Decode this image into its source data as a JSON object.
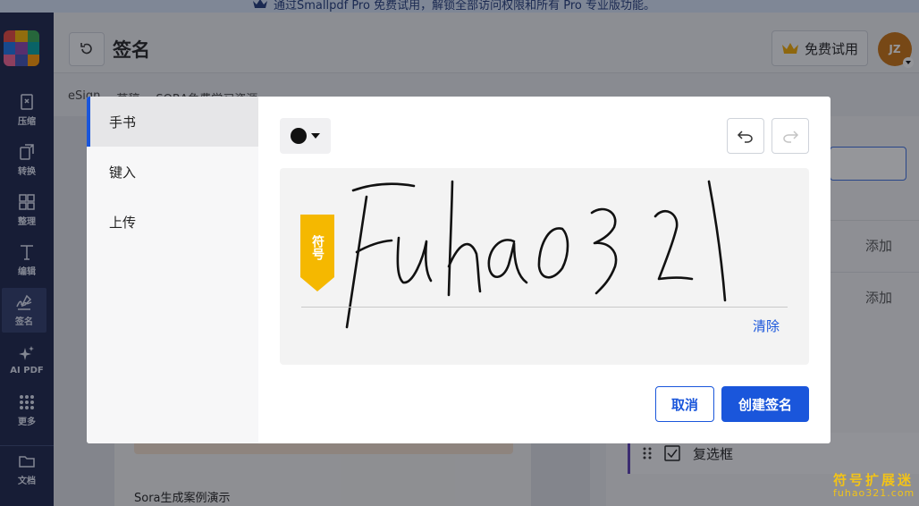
{
  "promo": {
    "text": "通过Smallpdf Pro 免费试用，解锁全部访问权限和所有 Pro 专业版功能。"
  },
  "sidebar": {
    "items": [
      {
        "label": "压缩",
        "icon": "compress-icon"
      },
      {
        "label": "转换",
        "icon": "convert-icon"
      },
      {
        "label": "整理",
        "icon": "organize-icon"
      },
      {
        "label": "编辑",
        "icon": "edit-icon"
      },
      {
        "label": "签名",
        "icon": "sign-icon"
      },
      {
        "label": "AI PDF",
        "icon": "ai-sparkle-icon"
      },
      {
        "label": "更多",
        "icon": "more-grid-icon"
      },
      {
        "label": "文档",
        "icon": "folder-icon"
      }
    ],
    "active": "签名",
    "logo_colors": [
      "#e8453c",
      "#f7b500",
      "#35a853",
      "#1b74e8",
      "#8e44ad",
      "#00a3a3",
      "#f06292",
      "#3f51b5",
      "#ff9800"
    ]
  },
  "header": {
    "title": "签名",
    "trial_label": "免费试用",
    "avatar_initials": "JZ"
  },
  "breadcrumbs": [
    "eSign",
    "草稿",
    "SORA免费学习资源"
  ],
  "background": {
    "doc_caption": "Sora生成案例演示",
    "add_label_1": "添加",
    "add_label_2": "添加",
    "checkbox_label": "复选框"
  },
  "modal": {
    "tabs": [
      "手书",
      "键入",
      "上传"
    ],
    "active_tab": "手书",
    "pen_color": "#111111",
    "tag_text": "符号",
    "clear_label": "清除",
    "cancel_label": "取消",
    "create_label": "创建签名"
  },
  "watermark": {
    "line1": "符号扩展迷",
    "line2": "fuhao321.com"
  },
  "colors": {
    "accent": "#1a56db",
    "sidebar_bg": "#1a2349",
    "tag": "#f5b800",
    "avatar": "#c8710f"
  }
}
